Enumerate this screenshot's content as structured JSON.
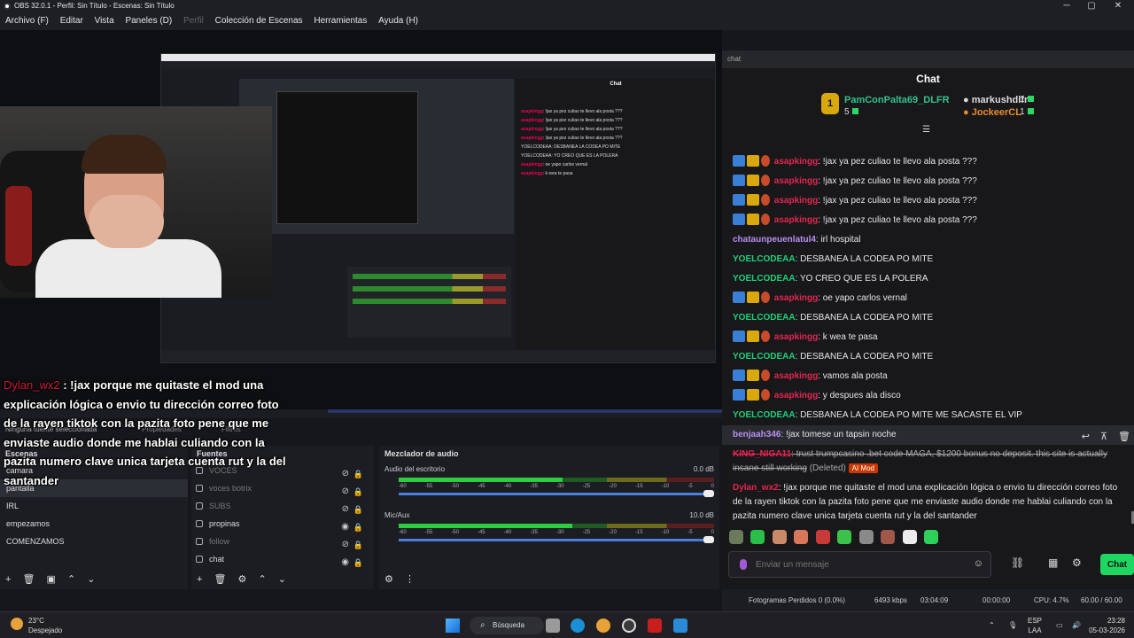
{
  "window": {
    "title": "OBS 32.0.1 - Perfil: Sin Título - Escenas: Sin Título"
  },
  "menu": [
    "Archivo (F)",
    "Editar",
    "Vista",
    "Paneles (D)",
    "Perfil",
    "Colección de Escenas",
    "Herramientas",
    "Ayuda (H)"
  ],
  "overlay": {
    "user": "Dylan_wx2",
    "text": " : !jax porque me quitaste el mod una explicación lógica o envio tu dirección correo foto de la rayen tiktok con la pazita foto pene que me enviaste audio donde me hablai culiando con la pazita numero clave unica tarjeta cuenta rut y la del santander"
  },
  "preview_ghost": {
    "no_source": "Ninguna fuente seleccionada",
    "properties": "Propiedades",
    "filters": "Filtros"
  },
  "scenes": {
    "title": "Escenas",
    "items": [
      "camara",
      "pantalla",
      "IRL",
      "empezamos",
      "COMENZAMOS"
    ]
  },
  "sources": {
    "title": "Fuentes",
    "items": [
      {
        "label": "VOCES",
        "visible": false
      },
      {
        "label": "voces botrix",
        "visible": false
      },
      {
        "label": "SUBS",
        "visible": false
      },
      {
        "label": "propinas",
        "visible": true
      },
      {
        "label": "follow",
        "visible": false
      },
      {
        "label": "chat",
        "visible": true
      }
    ]
  },
  "mixer": {
    "title": "Mezclador de audio",
    "tracks": [
      {
        "name": "Audio del escritorio",
        "db": "0.0 dB",
        "level": 0.52
      },
      {
        "name": "Mic/Aux",
        "db": "10.0 dB",
        "level": 0.55
      }
    ],
    "scale": [
      "-60",
      "-55",
      "-50",
      "-45",
      "-40",
      "-35",
      "-30",
      "-25",
      "-20",
      "-15",
      "-10",
      "-5",
      "0"
    ]
  },
  "chat": {
    "window_title": "chat",
    "header": "Chat",
    "leaders": {
      "first": {
        "rank": "1",
        "name": "PamConPalta69_DLFR",
        "count": "5"
      },
      "second": {
        "name": "markushdlfr",
        "count": "1"
      },
      "third": {
        "name": "JockeerCL",
        "count": "1"
      }
    },
    "messages": [
      {
        "user": "asapkingg",
        "text": ": !jax ya pez culiao te llevo ala posta ???"
      },
      {
        "user": "asapkingg",
        "text": ": !jax ya pez culiao te llevo ala posta ???"
      },
      {
        "user": "asapkingg",
        "text": ": !jax ya pez culiao te llevo ala posta ???"
      },
      {
        "user": "asapkingg",
        "text": ": !jax ya pez culiao te llevo ala posta ???"
      },
      {
        "user": "chataunpeuenlatul4",
        "text": ": irl hospital"
      },
      {
        "user": "YOELCODEAA",
        "text": ": DESBANEA LA CODEA PO MITE"
      },
      {
        "user": "YOELCODEAA",
        "text": ": YO CREO QUE ES LA POLERA"
      },
      {
        "user": "asapkingg",
        "text": ": oe yapo carlos vernal"
      },
      {
        "user": "YOELCODEAA",
        "text": ": DESBANEA LA CODEA PO MITE"
      },
      {
        "user": "asapkingg",
        "text": ": k wea te pasa"
      },
      {
        "user": "YOELCODEAA",
        "text": ": DESBANEA LA CODEA PO MITE"
      },
      {
        "user": "asapkingg",
        "text": ": vamos ala posta"
      },
      {
        "user": "asapkingg",
        "text": ": y despues ala disco"
      },
      {
        "user": "YOELCODEAA",
        "text": ": DESBANEA LA CODEA PO MITE ME SACASTE EL VIP"
      },
      {
        "user": "benjaah346",
        "text": ": !jax tomese un tapsin noche"
      }
    ],
    "deleted_msg": {
      "user": "KING_NIGA11",
      "text": ": trust trumpcasino .bet code MAGA, $1200 bonus no deposit. this site is actually insane still working",
      "tag": "(Deleted)",
      "badge": "AI Mod"
    },
    "last_msg": {
      "user": "Dylan_wx2",
      "text": ": !jax porque me quitaste el mod una explicación lógica o envio tu dirección correo foto de la rayen tiktok con la pazita foto pene que me enviaste audio donde me hablai culiando con la pazita numero clave unica tarjeta cuenta rut y la del santander"
    },
    "input_placeholder": "Enviar un mensaje",
    "send_label": "Chat"
  },
  "status": {
    "dropped": "Fotogramas Perdidos 0 (0.0%)",
    "bitrate": "6493 kbps",
    "live_time": "03:04:09",
    "rec_time": "00:00:00",
    "cpu": "CPU: 4.7%",
    "fps": "60.00 / 60.00 FPS"
  },
  "taskbar": {
    "temp": "23°C",
    "weather": "Despejado",
    "search": "Búsqueda",
    "lang1": "ESP",
    "lang2": "LAA",
    "time": "23:28",
    "date": "05-03-2026"
  },
  "colors": {
    "accent_green": "#1ed760",
    "username_red": "#e3254f",
    "mod_green": "#1fd07a"
  }
}
